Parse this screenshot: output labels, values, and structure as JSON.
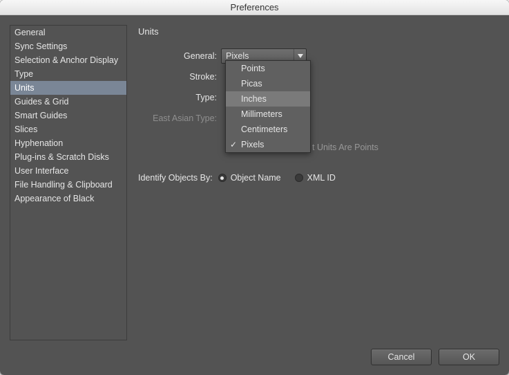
{
  "window": {
    "title": "Preferences"
  },
  "sidebar": {
    "items": [
      "General",
      "Sync Settings",
      "Selection & Anchor Display",
      "Type",
      "Units",
      "Guides & Grid",
      "Smart Guides",
      "Slices",
      "Hyphenation",
      "Plug-ins & Scratch Disks",
      "User Interface",
      "File Handling & Clipboard",
      "Appearance of Black"
    ],
    "selected_index": 4
  },
  "panel": {
    "title": "Units",
    "labels": {
      "general": "General:",
      "stroke": "Stroke:",
      "type": "Type:",
      "east_asian": "East Asian Type:",
      "identify": "Identify Objects By:"
    },
    "general_value": "Pixels",
    "hint_partial": "t Units Are Points",
    "radio": {
      "object_name": "Object Name",
      "xml_id": "XML ID",
      "selected": "object_name"
    }
  },
  "dropdown": {
    "options": [
      "Points",
      "Picas",
      "Inches",
      "Millimeters",
      "Centimeters",
      "Pixels"
    ],
    "hover_index": 2,
    "checked_index": 5
  },
  "buttons": {
    "cancel": "Cancel",
    "ok": "OK"
  }
}
